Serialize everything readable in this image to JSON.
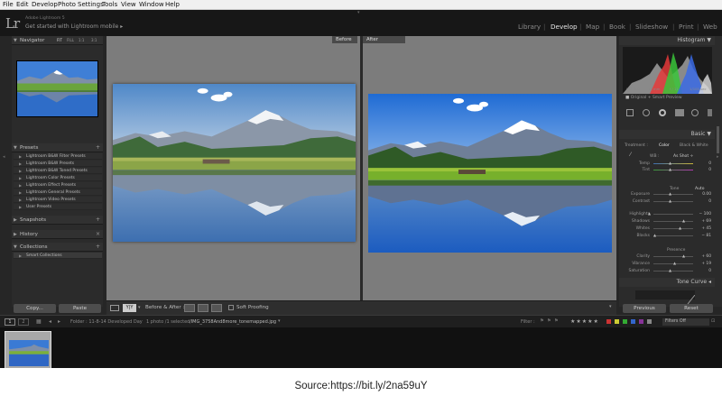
{
  "menu": [
    "File",
    "Edit",
    "Develop",
    "Photo",
    "Settings",
    "Tools",
    "View",
    "Window",
    "Help"
  ],
  "app": {
    "logo": "Lr",
    "product": "Adobe Lightroom 5",
    "mobile_prompt": "Get started with Lightroom mobile",
    "mobile_arrow": "▸"
  },
  "modules": [
    "Library",
    "Develop",
    "Map",
    "Book",
    "Slideshow",
    "Print",
    "Web"
  ],
  "active_module": "Develop",
  "left_panel": {
    "navigator": {
      "title": "Navigator",
      "zoom": [
        "FIT",
        "FILL",
        "1:1",
        "3:1"
      ]
    },
    "presets": {
      "title": "Presets",
      "items": [
        "Lightroom B&W Filter Presets",
        "Lightroom B&W Presets",
        "Lightroom B&W Toned Presets",
        "Lightroom Color Presets",
        "Lightroom Effect Presets",
        "Lightroom General Presets",
        "Lightroom Video Presets",
        "User Presets"
      ]
    },
    "snapshots": "Snapshots",
    "history": "History",
    "collections": {
      "title": "Collections",
      "items": [
        "Smart Collections"
      ]
    },
    "copy_button": "Copy...",
    "paste_button": "Paste"
  },
  "view": {
    "before_label": "Before",
    "after_label": "After"
  },
  "toolbar": {
    "view_mode": "Y|Y",
    "before_after": "Before & After :",
    "soft_proofing": "Soft Proofing"
  },
  "right_panel": {
    "histogram": "Histogram",
    "hist_readout": [
      "ISO 100",
      "15 mm",
      "f / 11",
      "1/100 sec"
    ],
    "original_note": "Original + Smart Preview",
    "basic": "Basic",
    "treatment": "Treatment :",
    "color": "Color",
    "bw": "Black & White",
    "wb": "WB :",
    "wb_value": "As Shot ÷",
    "sliders_top": [
      {
        "label": "Temp",
        "value": "0"
      },
      {
        "label": "Tint",
        "value": "0"
      }
    ],
    "tone": "Tone",
    "auto": "Auto",
    "sliders_tone": [
      {
        "label": "Exposure",
        "value": "0.00"
      },
      {
        "label": "Contrast",
        "value": "0"
      }
    ],
    "sliders_tone2": [
      {
        "label": "Highlights",
        "value": "− 100"
      },
      {
        "label": "Shadows",
        "value": "+ 69"
      },
      {
        "label": "Whites",
        "value": "+ 45"
      },
      {
        "label": "Blacks",
        "value": "− 81"
      }
    ],
    "presence": "Presence",
    "sliders_presence": [
      {
        "label": "Clarity",
        "value": "+ 60"
      },
      {
        "label": "Vibrance",
        "value": "+ 19"
      },
      {
        "label": "Saturation",
        "value": "0"
      }
    ],
    "tone_curve": "Tone Curve",
    "previous_button": "Previous",
    "reset_button": "Reset"
  },
  "filmstrip": {
    "pages": [
      "1",
      "2"
    ],
    "folder": "Folder : 11-8-14 Developed Day",
    "count": "1 photo /1 selected",
    "filename": "/IMG_3758And8more_tonemapped.jpg",
    "filter": "Filter :",
    "filters_off": "Filters Off"
  },
  "caption": "Source:https://bit.ly/2na59uY"
}
